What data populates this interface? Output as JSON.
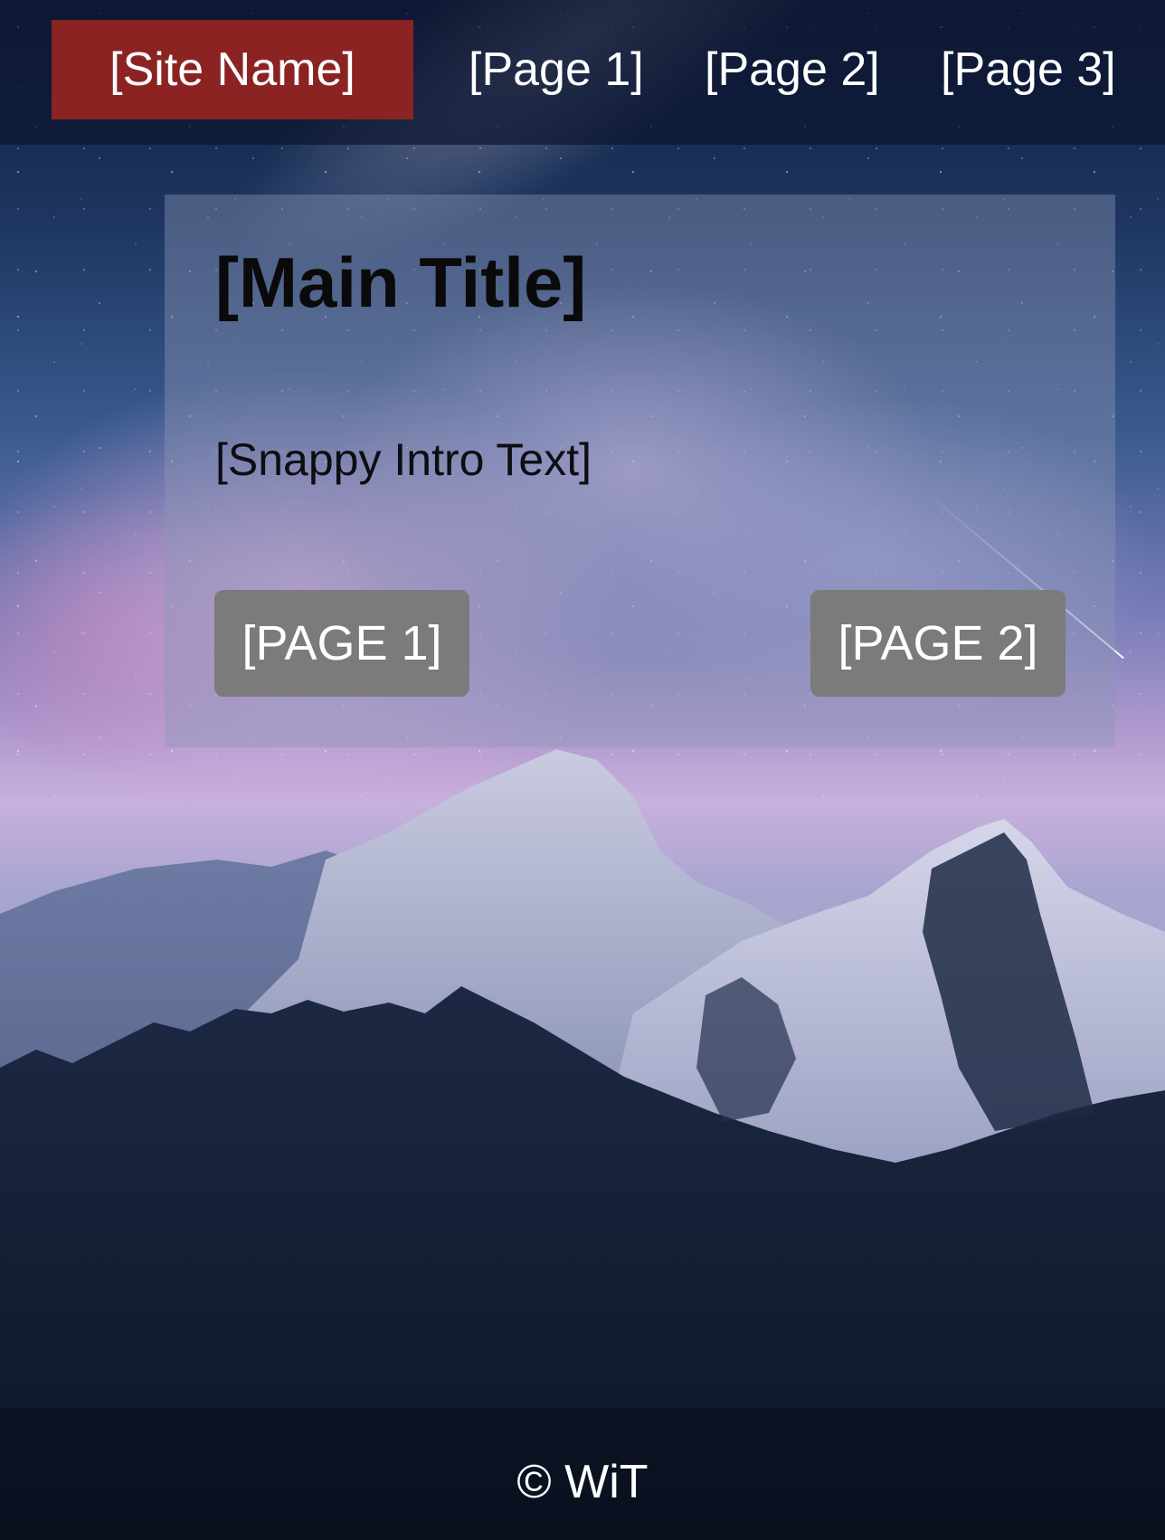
{
  "nav": {
    "site_name": "[Site Name]",
    "links": [
      {
        "label": "[Page 1]"
      },
      {
        "label": "[Page 2]"
      },
      {
        "label": "[Page 3]"
      }
    ]
  },
  "hero": {
    "title": "[Main Title]",
    "intro": "[Snappy Intro Text]",
    "buttons": [
      {
        "label": "[PAGE 1]"
      },
      {
        "label": "[PAGE 2]"
      }
    ]
  },
  "footer": {
    "text": "© WiT"
  },
  "colors": {
    "site_name_bg": "#8b2323",
    "button_bg": "#7b7b7b",
    "navbar_bg": "#0c1630",
    "text_light": "#ffffff",
    "text_dark": "#0a0a0a"
  },
  "background": {
    "icon": "mountain-night-sky-image"
  }
}
